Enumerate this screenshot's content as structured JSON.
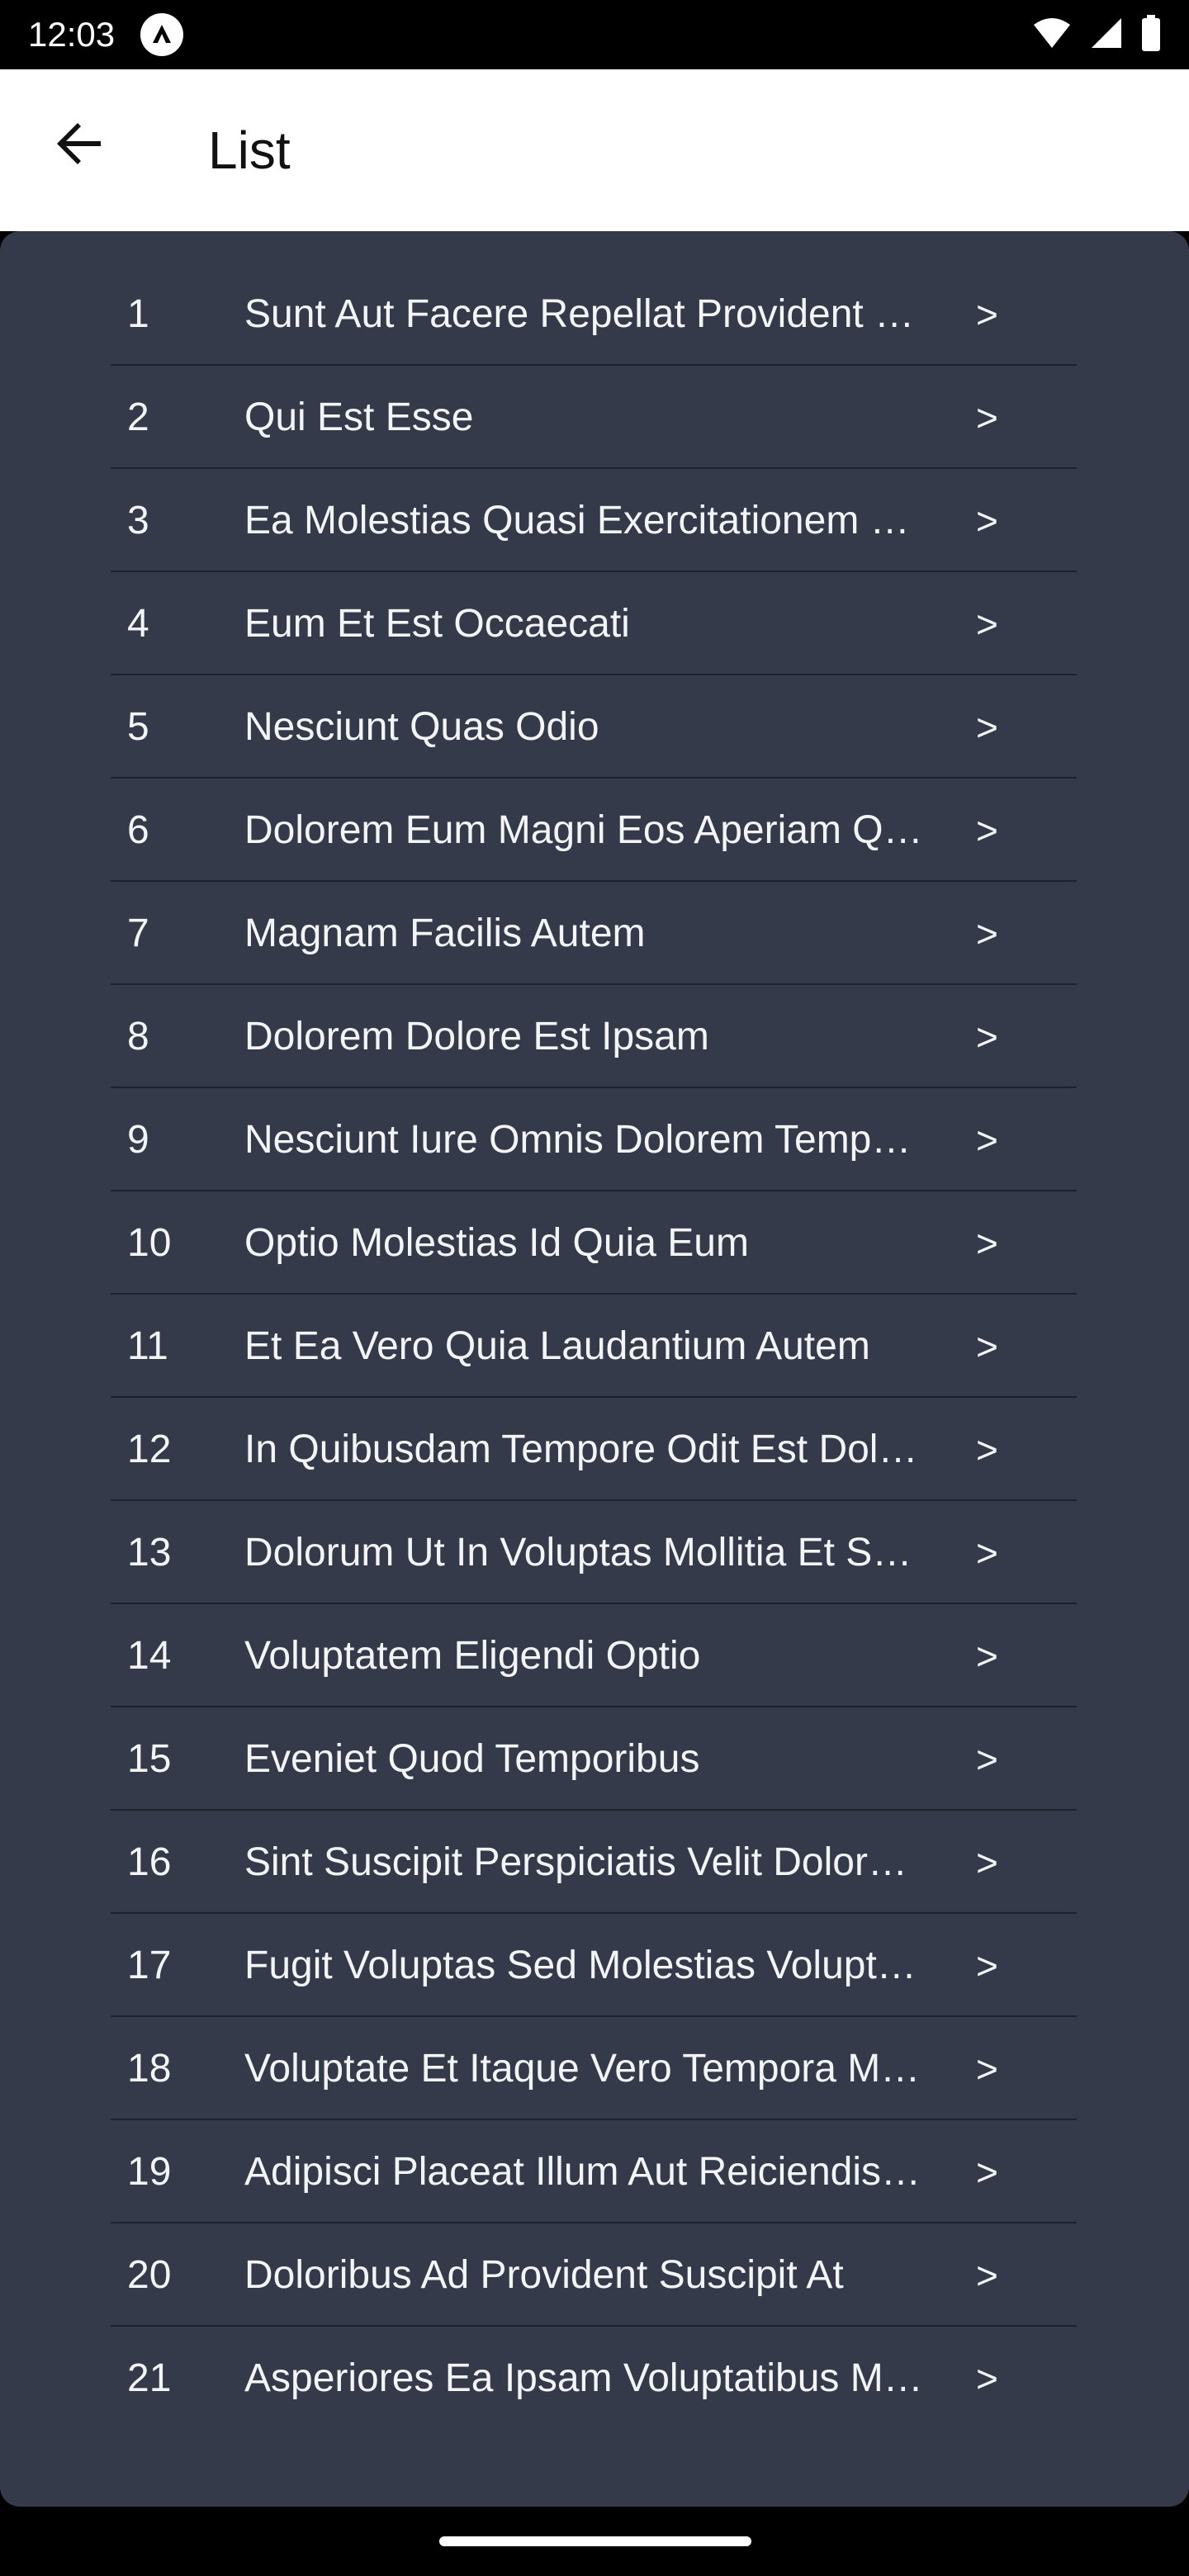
{
  "status_bar": {
    "time": "12:03",
    "app_icon": "app-notification-icon",
    "icons": [
      "wifi-icon",
      "signal-icon",
      "battery-icon"
    ]
  },
  "app_bar": {
    "back_icon": "arrow-left-icon",
    "title": "List"
  },
  "colors": {
    "app_bar_bg": "#ffffff",
    "panel_bg": "#343a4a",
    "divider": "#1e222b",
    "text": "#f3f4f6"
  },
  "list": {
    "chevron_glyph": ">",
    "items": [
      {
        "num": "1",
        "title": "Sunt Aut Facere Repellat Provident Occaecati Excepturi Optio Reprehenderit",
        "chevron": ">"
      },
      {
        "num": "2",
        "title": "Qui Est Esse",
        "chevron": ">"
      },
      {
        "num": "3",
        "title": "Ea Molestias Quasi Exercitationem Repellat Qui Ipsa Sit Aut",
        "chevron": ">"
      },
      {
        "num": "4",
        "title": "Eum Et Est Occaecati",
        "chevron": ">"
      },
      {
        "num": "5",
        "title": "Nesciunt Quas Odio",
        "chevron": ">"
      },
      {
        "num": "6",
        "title": "Dolorem Eum Magni Eos Aperiam Quia",
        "chevron": ">"
      },
      {
        "num": "7",
        "title": "Magnam Facilis Autem",
        "chevron": ">"
      },
      {
        "num": "8",
        "title": "Dolorem Dolore Est Ipsam",
        "chevron": ">"
      },
      {
        "num": "9",
        "title": "Nesciunt Iure Omnis Dolorem Tempora Et Accusantium",
        "chevron": ">"
      },
      {
        "num": "10",
        "title": "Optio Molestias Id Quia Eum",
        "chevron": ">"
      },
      {
        "num": "11",
        "title": "Et Ea Vero Quia Laudantium Autem",
        "chevron": ">"
      },
      {
        "num": "12",
        "title": "In Quibusdam Tempore Odit Est Dolorem",
        "chevron": ">"
      },
      {
        "num": "13",
        "title": "Dolorum Ut In Voluptas Mollitia Et Saepe Quo Animi",
        "chevron": ">"
      },
      {
        "num": "14",
        "title": "Voluptatem Eligendi Optio",
        "chevron": ">"
      },
      {
        "num": "15",
        "title": "Eveniet Quod Temporibus",
        "chevron": ">"
      },
      {
        "num": "16",
        "title": "Sint Suscipit Perspiciatis Velit Dolorum Rerum Ipsa Laboriosam Odio",
        "chevron": ">"
      },
      {
        "num": "17",
        "title": "Fugit Voluptas Sed Molestias Voluptatem Provident",
        "chevron": ">"
      },
      {
        "num": "18",
        "title": "Voluptate Et Itaque Vero Tempora Molestiae",
        "chevron": ">"
      },
      {
        "num": "19",
        "title": "Adipisci Placeat Illum Aut Reiciendis Qui",
        "chevron": ">"
      },
      {
        "num": "20",
        "title": "Doloribus Ad Provident Suscipit At",
        "chevron": ">"
      },
      {
        "num": "21",
        "title": "Asperiores Ea Ipsam Voluptatibus Modi Minima Quia Sint",
        "chevron": ">"
      }
    ]
  },
  "nav_bar": {
    "home_handle": "home-gesture-handle"
  }
}
